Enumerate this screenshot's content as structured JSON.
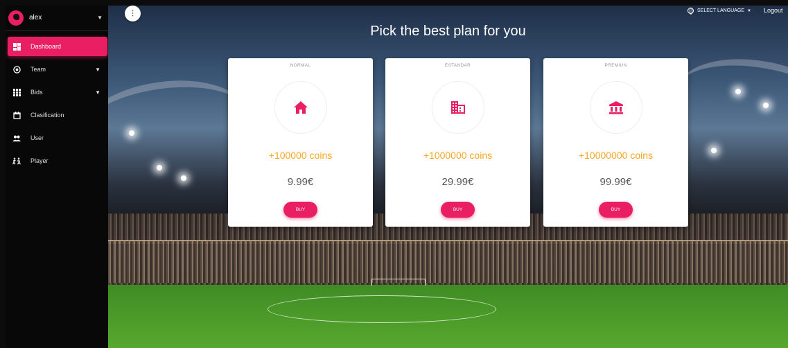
{
  "sidebar": {
    "user": {
      "name": "alex"
    },
    "items": [
      {
        "label": "Dashboard",
        "icon": "dashboard-icon",
        "active": true
      },
      {
        "label": "Team",
        "icon": "soccer-ball-icon",
        "expandable": true
      },
      {
        "label": "Bids",
        "icon": "grid-icon",
        "expandable": true
      },
      {
        "label": "Clasification",
        "icon": "calendar-icon"
      },
      {
        "label": "User",
        "icon": "people-icon"
      },
      {
        "label": "Player",
        "icon": "players-icon"
      }
    ]
  },
  "topbar": {
    "menu_icon": "more-vert-icon",
    "language_label": "SELECT LANGUAGE",
    "language_icon": "globe-icon",
    "logout_label": "Logout"
  },
  "main": {
    "headline": "Pick the best plan for you",
    "plans": [
      {
        "title": "NORMAL",
        "icon": "home-icon",
        "coins": "+100000 coins",
        "price": "9.99€",
        "button": "BUY"
      },
      {
        "title": "ESTANDAR",
        "icon": "business-icon",
        "coins": "+1000000 coins",
        "price": "29.99€",
        "button": "BUY"
      },
      {
        "title": "PREMIUN",
        "icon": "bank-icon",
        "coins": "+10000000 coins",
        "price": "99.99€",
        "button": "BUY"
      }
    ]
  },
  "colors": {
    "accent": "#e91e63",
    "coins": "#f6a623",
    "sidebar_bg": "#080808"
  }
}
